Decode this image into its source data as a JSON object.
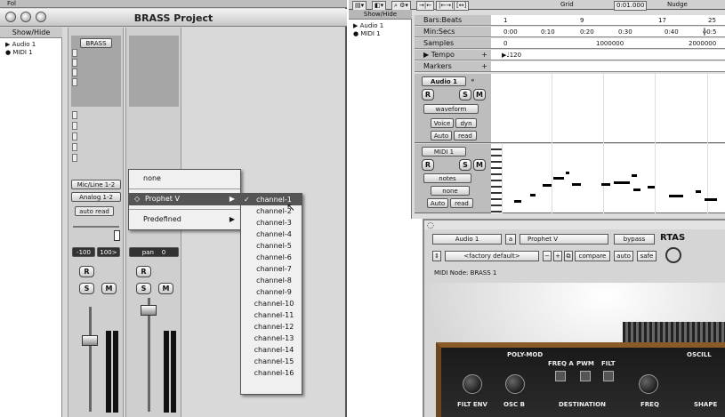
{
  "mix_window": {
    "title": "BRASS Project",
    "showhide_label": "Show/Hide",
    "tracks": [
      "Audio 1",
      "MIDI 1"
    ],
    "top_left_label": "Fol",
    "insert_label": "BRASS",
    "io_input": "Mic/Line 1-2",
    "io_output": "Analog 1-2",
    "automation": "auto read",
    "vol_1": "-100",
    "vol_2": "100>",
    "pan_label": "pan",
    "pan_value": "0",
    "record_btn": "R",
    "solo_btn": "S",
    "mute_btn": "M"
  },
  "insert_menu": {
    "items": [
      "none",
      "Prophet V",
      "Predefined"
    ],
    "selected": "Prophet V"
  },
  "channel_submenu": {
    "items": [
      "channel-1",
      "channel-2",
      "channel-3",
      "channel-4",
      "channel-5",
      "channel-6",
      "channel-7",
      "channel-8",
      "channel-9",
      "channel-10",
      "channel-11",
      "channel-12",
      "channel-13",
      "channel-14",
      "channel-15",
      "channel-16"
    ],
    "checked": "channel-1"
  },
  "edit_window": {
    "toolbar": [
      "Grid",
      "0:01.000",
      "Nudge"
    ],
    "showhide_label": "Show/Hide",
    "tracks": [
      "Audio 1",
      "MIDI 1"
    ],
    "rulers": [
      "Bars:Beats",
      "Min:Secs",
      "Samples",
      "Tempo",
      "Markers"
    ],
    "bars_ticks": [
      "1",
      "9",
      "17",
      "25"
    ],
    "mins_ticks": [
      "0:00",
      "0:10",
      "0:20",
      "0:30",
      "0:40",
      "0:5"
    ],
    "samples_ticks": [
      "0",
      "1000000",
      "2000000"
    ],
    "tempo_value": "120",
    "audio_track": {
      "name": "Audio 1",
      "view": "waveform",
      "voice": "Voice",
      "voice_mode": "dyn",
      "auto": "Auto",
      "auto_mode": "read"
    },
    "midi_track": {
      "name": "MIDI 1",
      "view": "notes",
      "patch": "none",
      "auto": "Auto",
      "auto_mode": "read"
    }
  },
  "plugin_window": {
    "track": "Audio 1",
    "insert_slot": "a",
    "plugin_name": "Prophet V",
    "bypass": "bypass",
    "format": "RTAS",
    "preset": "<factory default>",
    "compare": "compare",
    "auto": "auto",
    "safe": "safe",
    "midi_node": "MIDI Node: BRASS 1"
  },
  "synth_panel": {
    "labels": [
      "POLY-MOD",
      "FREQ A",
      "PWM",
      "FILT",
      "OSCILL",
      "FILT ENV",
      "OSC B",
      "DESTINATION",
      "FREQ",
      "SHAPE"
    ]
  }
}
